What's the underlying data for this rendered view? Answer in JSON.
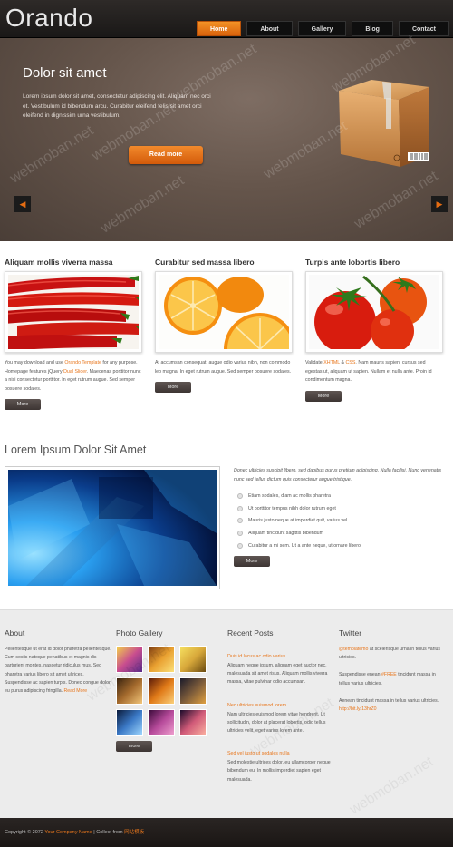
{
  "header": {
    "logo": "Orando",
    "nav": [
      {
        "label": "Home",
        "active": true
      },
      {
        "label": "About",
        "active": false
      },
      {
        "label": "Gallery",
        "active": false
      },
      {
        "label": "Blog",
        "active": false
      },
      {
        "label": "Contact",
        "active": false
      }
    ]
  },
  "hero": {
    "title": "Dolor sit amet",
    "text": "Lorem ipsum dolor sit amet, consectetur adipiscing elit. Aliquam nec orci et. Vestibulum id bibendum arcu. Curabitur eleifend felis sit amet orci eleifend in dignissim urna vestibulum.",
    "button": "Read more",
    "prev": "◀",
    "next": "▶"
  },
  "features": [
    {
      "title": "Aliquam mollis viverra massa",
      "text_a": "You may download and use ",
      "link_a": "Orando Template",
      "text_b": " for any purpose. Homepage features jQuery ",
      "link_b": "Dual Slider",
      "text_c": ". Maecenas porttitor nunc a nisi consectetur porttitor. In eget rutrum augue. Sed semper posuere sodales.",
      "more": "More"
    },
    {
      "title": "Curabitur sed massa libero",
      "text": "At accumsan consequat, augue odio varius nibh, non commodo leo magna. In eget rutrum augue. Sed semper posuere sodales.",
      "more": "More"
    },
    {
      "title": "Turpis ante lobortis libero",
      "text_a": "Validate ",
      "link_a": "XHTML",
      "text_b": " & ",
      "link_b": "CSS",
      "text_c": ". Nam mauris sapien, cursus sed egestas ut, aliquam ut sapien. Nullam et nulla ante. Proin id condimentum magna.",
      "more": "More"
    }
  ],
  "lorem": {
    "title": "Lorem Ipsum Dolor Sit Amet",
    "intro": "Donec ultricies suscipit libero, sed dapibus purus pretium adipiscing. Nulla facilisi. Nunc venenatis nunc sed tellus dictum quis consectetur augue tristique.",
    "bullets": [
      "Etiam sodales, diam ac mollis pharetra",
      "Ut porttitor tempus nibh dolor rutrum eget",
      "Mauris justo neque at imperdiet quit, varius vel",
      "Aliquam tincidunt sagittis bibendum",
      "Curabitur a mi sem. Ut a ante neque, ut ornare libero"
    ],
    "more": "More"
  },
  "bottom": {
    "about": {
      "title": "About",
      "text": "Pellentesque ut erat id dolor pharetra pellentesque. Cum sociis natoque penatibus et magnis dis parturient montes, nascetur ridiculus mus. Sed pharetra varius libero sit amet ultrices. Suspendisse ac sapien turpis. Donec congue dolor eu purus adipiscing fringilla. ",
      "link": "Read More"
    },
    "gallery": {
      "title": "Photo Gallery",
      "more": "more",
      "thumbs": [
        "#c84d8f",
        "#e9a030",
        "#d8c43a",
        "#a46a2d",
        "#e07a18",
        "#3a5a8a",
        "#3b79c6",
        "#b64a9a",
        "#d05a78"
      ]
    },
    "posts": {
      "title": "Recent Posts",
      "items": [
        {
          "title": "Duis id lacus ac odio varius",
          "text": "Aliquam neque ipsum, aliquam eget auctor nec, malesuada sit amet risus. Aliquam mollis viverra massa, vitae pulvinar odio accumsan."
        },
        {
          "title": "Nec ultricies euismod lorem",
          "text": "Nam ultricies euismod lorem vitae hendrerit. Ut sollicitudin, dolor at placerat lobortis, odio tellus ultricies velit, eget varius lorem ante."
        },
        {
          "title": "Sed vel justo ut sodales nulla",
          "text": "Sed molestie ultrices dolor, eu ullamcorper neque bibendum eu. In mollis imperdiet sapien eget malesuada."
        }
      ]
    },
    "twitter": {
      "title": "Twitter",
      "tweet1_link": "@templatemo",
      "tweet1_text": " at scelerisque urna in tellus varius ultricies.",
      "tweet2_a": "Suspendisse enean ",
      "tweet2_link": "#FREE",
      "tweet2_b": " tincidunt massa in tellus varius ultricies.",
      "tweet3_text": "Aenean tincidunt massa in tellus varius ultricies. ",
      "tweet3_link": "http://bit.ly/13hrZ0"
    }
  },
  "footer": {
    "copyright": "Copyright © 2072 ",
    "company": "Your Company Name",
    "sep": " | Collect from ",
    "collect": "网站模板"
  },
  "watermark": "webmoban.net",
  "colors": {
    "accent": "#e8761c",
    "header": "#1f1c1b",
    "hero": "#65554b"
  }
}
